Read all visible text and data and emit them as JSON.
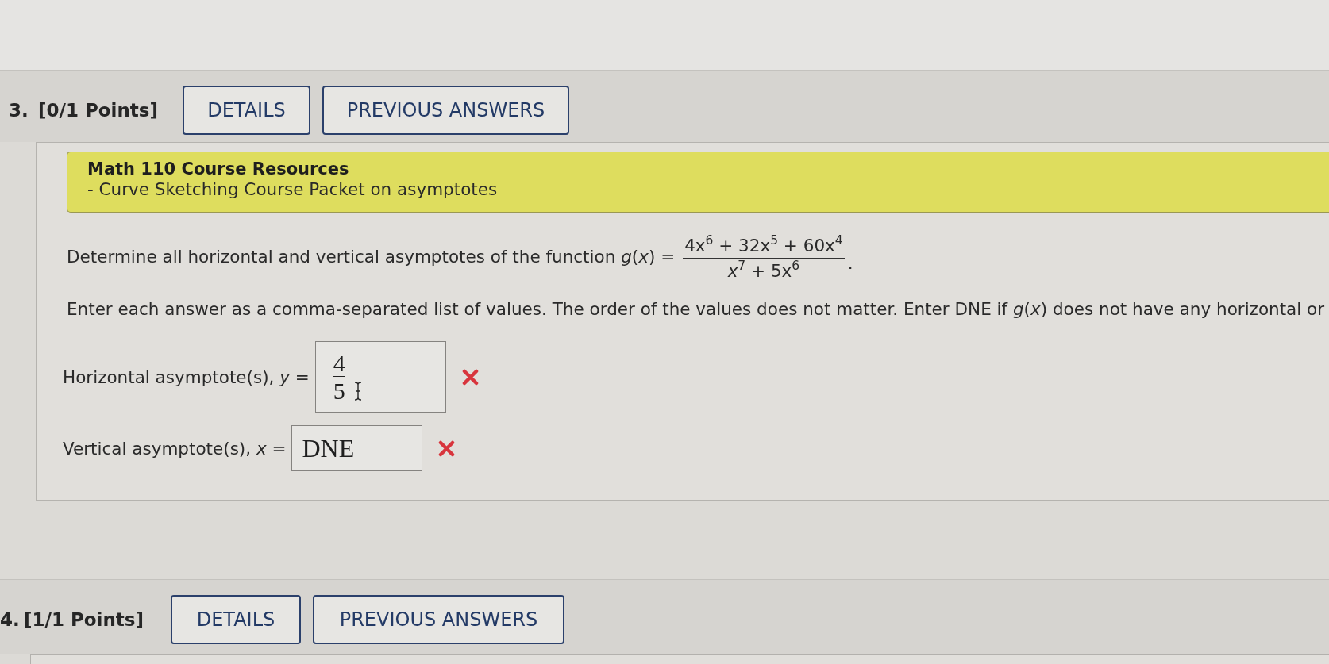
{
  "questions": [
    {
      "number": "3.",
      "points": "[0/1 Points]",
      "buttons": [
        "DETAILS",
        "PREVIOUS ANSWERS"
      ],
      "resources": {
        "title": "Math 110 Course Resources",
        "item": "- Curve Sketching Course Packet on asymptotes"
      },
      "prompt": {
        "text": "Determine all horizontal and vertical asymptotes of the function *g*(*x*) =",
        "numerator": "4x$^{6}$ + 32x$^{5}$ + 60x$^{4}$",
        "denominator": "*x*$^{7}$ + 5x$^{6}$",
        "end": "."
      },
      "instructions": "Enter each answer as a comma-separated list of values. The order of the values does not matter. Enter DNE if *g*(*x*) does not have any horizontal or",
      "answers": [
        {
          "label": "Horizontal asymptote(s), *y* =",
          "kind": "fraction",
          "numerator": "4",
          "denominator": "5",
          "correct": false
        },
        {
          "label": "Vertical asymptote(s), *x* =",
          "kind": "text",
          "value": "DNE",
          "correct": false
        }
      ]
    },
    {
      "number": "4.",
      "points": "[1/1 Points]",
      "buttons": [
        "DETAILS",
        "PREVIOUS ANSWERS"
      ]
    }
  ]
}
